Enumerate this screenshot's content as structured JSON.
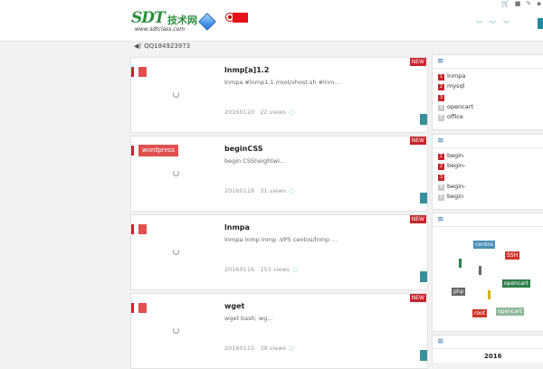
{
  "header": {
    "logo_text": "SDT",
    "logo_cn": "技术网",
    "logo_url": "www.sdtclass.com",
    "top_icons": [
      "shopping-cart-icon",
      "user-icon",
      "wrench-icon",
      "person-icon"
    ],
    "nav_items": [
      "﹀",
      "﹀",
      "﹀"
    ],
    "accent": "#1f8a9f"
  },
  "notice": {
    "text": "QQ184923973"
  },
  "posts": [
    {
      "category": "",
      "title": "lnmp[a]1.2",
      "excerpt": "lnmpa  #lnmp1.1  /root/vhost.sh  #lnm...",
      "date": "20160120",
      "views": "22 views",
      "badge": "NEW"
    },
    {
      "category": "wordpress",
      "title": "beginCSS",
      "excerpt": "begin CSSheightwi...",
      "date": "20160118",
      "views": "31 views",
      "badge": "NEW"
    },
    {
      "category": "",
      "title": "lnmpa",
      "excerpt": "lnmpa  lnmp lnmp  -VPS centos/lnmp ...",
      "date": "20160116",
      "views": "153 views",
      "badge": "NEW"
    },
    {
      "category": "",
      "title": "wget",
      "excerpt": "wget bash; wg...",
      "date": "20160115",
      "views": "39 views",
      "badge": "NEW"
    }
  ],
  "widget1": {
    "items": [
      {
        "num": "1",
        "label": "lnmpa"
      },
      {
        "num": "2",
        "label": "mysql"
      },
      {
        "num": "3",
        "label": ""
      },
      {
        "num": "4",
        "label": "opencart"
      },
      {
        "num": "5",
        "label": "office"
      }
    ]
  },
  "widget2": {
    "items": [
      {
        "num": "1",
        "label": "begin"
      },
      {
        "num": "2",
        "label": "begin-"
      },
      {
        "num": "3",
        "label": ""
      },
      {
        "num": "4",
        "label": "begin-"
      },
      {
        "num": "5",
        "label": "begin"
      }
    ]
  },
  "tags": [
    {
      "label": "centos",
      "color": "#4a8fb8"
    },
    {
      "label": "SSH",
      "color": "#d0342c"
    },
    {
      "label": "opencart",
      "color": "#2e7d4a"
    },
    {
      "label": "php",
      "color": "#666666"
    },
    {
      "label": "root",
      "color": "#d0342c"
    },
    {
      "label": "opencart",
      "color": "#8fb89a"
    }
  ],
  "calendar": {
    "year": "2016"
  }
}
